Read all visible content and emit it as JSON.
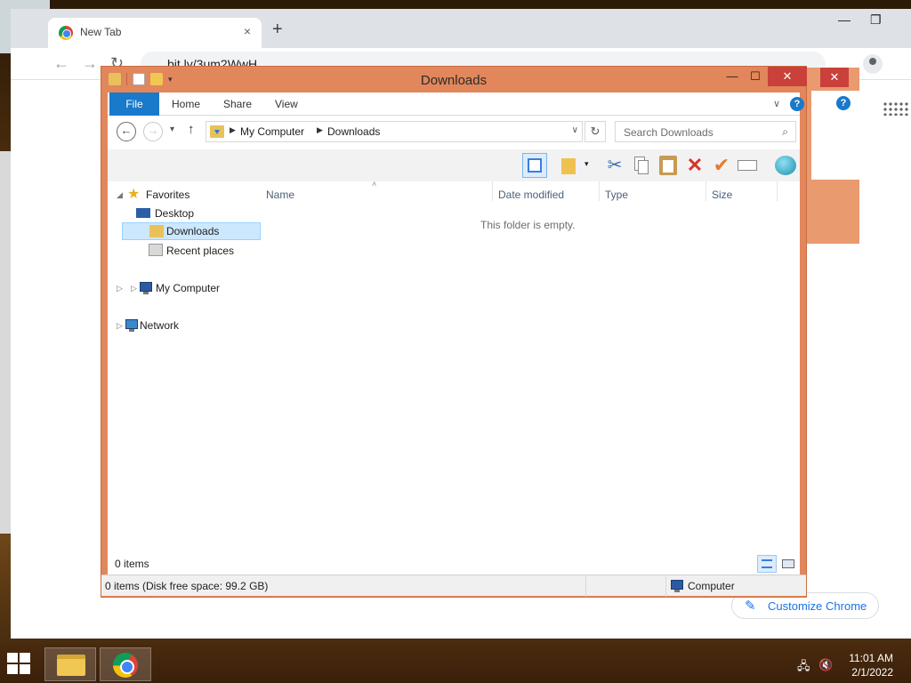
{
  "chrome": {
    "tab_title": "New Tab",
    "tab_close": "×",
    "new_tab": "+",
    "back": "←",
    "forward": "→",
    "reload": "↻",
    "url": "bit.ly/3um2WwH",
    "customize_label": "Customize Chrome",
    "customize_icon": "✎"
  },
  "explorer": {
    "title": "Downloads",
    "min": "—",
    "max": "☐",
    "close": "✕",
    "ribbon_tabs": [
      "File",
      "Home",
      "Share",
      "View"
    ],
    "help": "?",
    "chevron": "∨",
    "back": "←",
    "forward": "→",
    "recent_arrow": "▾",
    "up": "↑",
    "breadcrumb": [
      "My Computer",
      "Downloads"
    ],
    "crumb_sep": "▶",
    "addr_drop": "∨",
    "refresh": "↻",
    "search_placeholder": "Search Downloads",
    "search_icon": "⌕",
    "nav": {
      "favorites": "Favorites",
      "desktop": "Desktop",
      "downloads": "Downloads",
      "recent": "Recent places",
      "computer": "My Computer",
      "network": "Network",
      "expanded": "◢",
      "collapsed": "▷"
    },
    "columns": [
      "Name",
      "Date modified",
      "Type",
      "Size"
    ],
    "sort_caret": "˄",
    "empty": "This folder is empty.",
    "item_count": "0 items",
    "details_text": "0 items (Disk free space: 99.2 GB)",
    "details_location": "Computer"
  },
  "taskbar": {
    "time": "11:01 AM",
    "date": "2/1/2022",
    "network_icon": "🖧",
    "volume_icon": "🔇"
  },
  "colors": {
    "window_frame": "#e2865b",
    "close_red": "#c9413a",
    "file_tab_blue": "#1979ca",
    "selection": "#cce8ff"
  }
}
